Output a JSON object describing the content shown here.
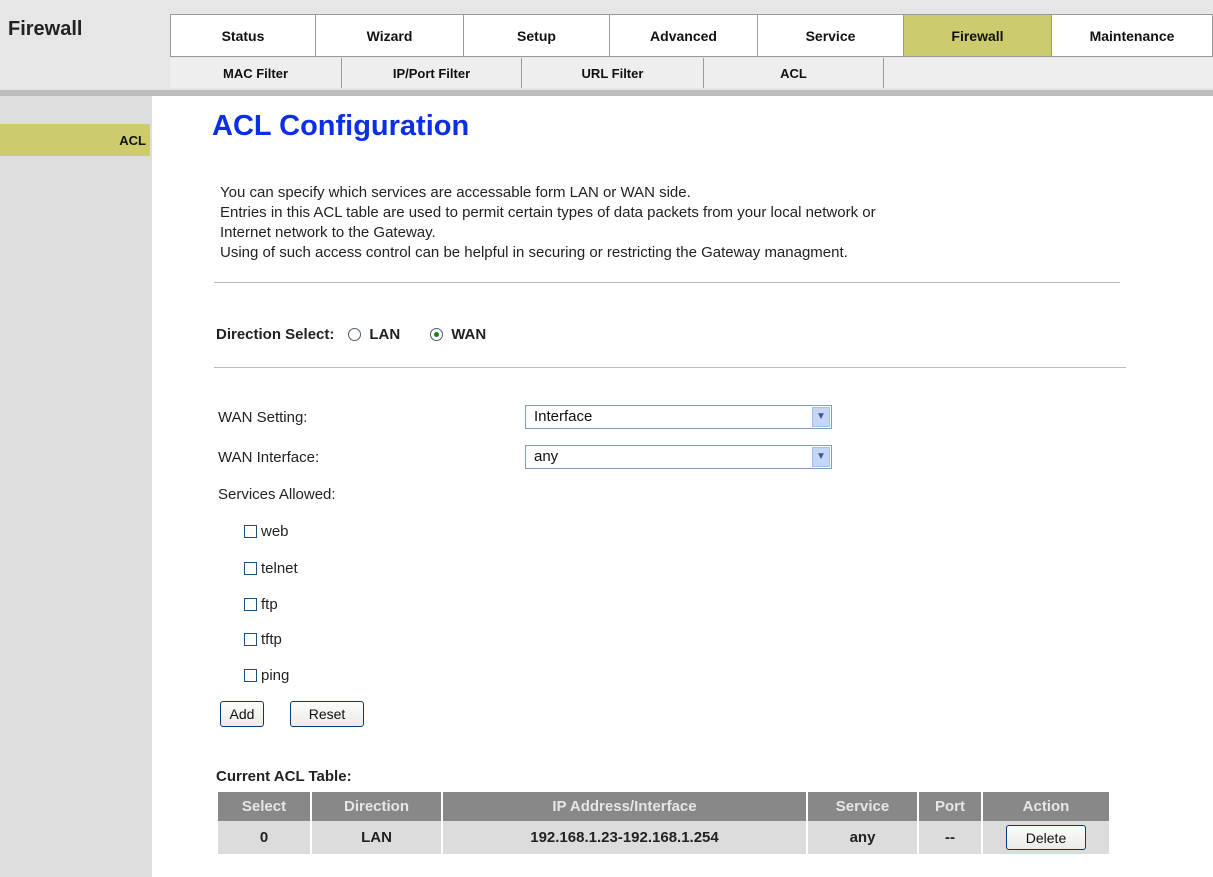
{
  "header": {
    "section_title": "Firewall",
    "main_tabs": [
      {
        "label": "Status"
      },
      {
        "label": "Wizard"
      },
      {
        "label": "Setup"
      },
      {
        "label": "Advanced"
      },
      {
        "label": "Service"
      },
      {
        "label": "Firewall"
      },
      {
        "label": "Maintenance"
      }
    ],
    "active_tab": "Firewall",
    "sub_tabs": [
      {
        "label": "MAC Filter"
      },
      {
        "label": "IP/Port Filter"
      },
      {
        "label": "URL Filter"
      },
      {
        "label": "ACL"
      },
      {
        "label": ""
      }
    ]
  },
  "sidebar": {
    "items": [
      {
        "label": "ACL"
      }
    ],
    "active": "ACL"
  },
  "main": {
    "title": "ACL Configuration",
    "description": [
      "You can specify which services are accessable form LAN or WAN side.",
      "Entries in this ACL table are used to permit certain types of data packets from your local network or",
      "Internet network to the Gateway.",
      "Using of such access control can be helpful in securing or restricting the Gateway managment."
    ],
    "direction": {
      "label": "Direction Select:",
      "options": [
        {
          "label": "LAN",
          "checked": false
        },
        {
          "label": "WAN",
          "checked": true
        }
      ]
    },
    "wan_setting": {
      "label": "WAN Setting:",
      "value": "Interface"
    },
    "wan_interface": {
      "label": "WAN Interface:",
      "value": "any"
    },
    "services": {
      "label": "Services Allowed:",
      "items": [
        {
          "label": "web",
          "checked": false
        },
        {
          "label": "telnet",
          "checked": false
        },
        {
          "label": "ftp",
          "checked": false
        },
        {
          "label": "tftp",
          "checked": false
        },
        {
          "label": "ping",
          "checked": false
        }
      ]
    },
    "buttons": {
      "add": "Add",
      "reset": "Reset"
    },
    "table": {
      "title": "Current ACL Table:",
      "columns": [
        "Select",
        "Direction",
        "IP Address/Interface",
        "Service",
        "Port",
        "Action"
      ],
      "rows": [
        {
          "select": "0",
          "direction": "LAN",
          "ip": "192.168.1.23-192.168.1.254",
          "service": "any",
          "port": "--",
          "action": "Delete"
        }
      ]
    }
  },
  "colors": {
    "accent": "#cccc6e",
    "title_blue": "#0a2fe6",
    "table_header": "#888888",
    "table_cell": "#dcdcdc"
  },
  "icons": {
    "dropdown": "chevron-down-icon"
  }
}
